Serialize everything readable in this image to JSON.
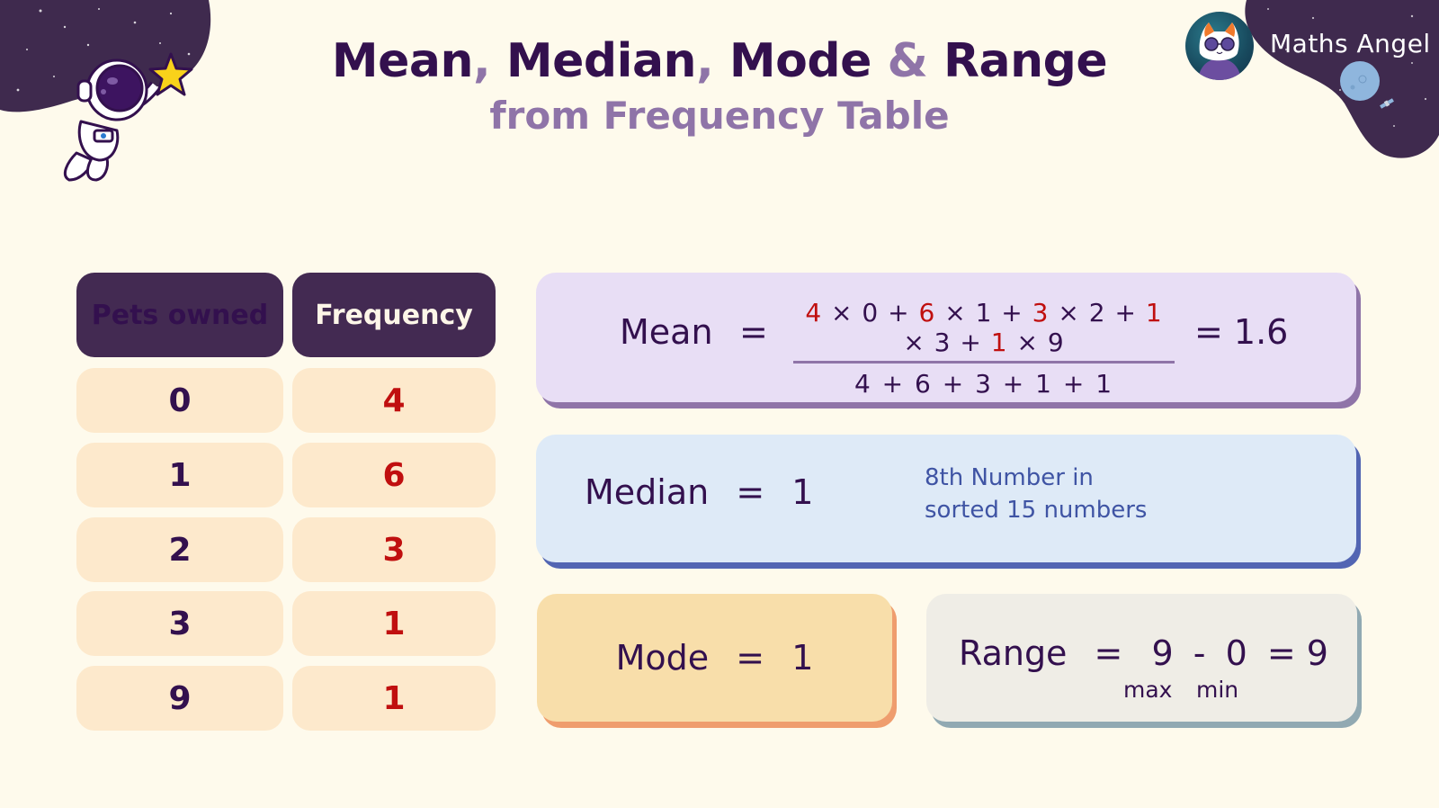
{
  "header": {
    "title_parts": [
      {
        "text": "Mean",
        "accent": false
      },
      {
        "text": ", ",
        "accent": true
      },
      {
        "text": "Median",
        "accent": false
      },
      {
        "text": ", ",
        "accent": true
      },
      {
        "text": "Mode",
        "accent": false
      },
      {
        "text": " & ",
        "accent": true
      },
      {
        "text": "Range",
        "accent": false
      }
    ],
    "subtitle": "from Frequency Table"
  },
  "brand": {
    "name": "Maths Angel",
    "avatar_icon": "cat-with-sunglasses-icon"
  },
  "decorations": {
    "left": "astronaut-holding-star-icon",
    "right": "moon-and-satellite-icon"
  },
  "table": {
    "headers": [
      "Pets owned",
      "Frequency"
    ],
    "rows": [
      {
        "value": "0",
        "frequency": "4"
      },
      {
        "value": "1",
        "frequency": "6"
      },
      {
        "value": "2",
        "frequency": "3"
      },
      {
        "value": "3",
        "frequency": "1"
      },
      {
        "value": "9",
        "frequency": "1"
      }
    ]
  },
  "mean": {
    "label": "Mean",
    "equals": "=",
    "numerator_terms": [
      {
        "f": "4",
        "x": "0"
      },
      {
        "f": "6",
        "x": "1"
      },
      {
        "f": "3",
        "x": "2"
      },
      {
        "f": "1",
        "x": "3"
      },
      {
        "f": "1",
        "x": "9"
      }
    ],
    "times": "×",
    "plus": "+",
    "denominator": "4 + 6 + 3 + 1 + 1",
    "result": "= 1.6"
  },
  "median": {
    "label": "Median",
    "equals": "=",
    "value": "1",
    "note_line1": "8th Number in",
    "note_line2": "sorted 15 numbers"
  },
  "mode": {
    "label": "Mode",
    "equals": "=",
    "value": "1"
  },
  "range": {
    "label": "Range",
    "equals": "=",
    "max": "9",
    "minus": "-",
    "min": "0",
    "result": "= 9",
    "max_label": "max",
    "min_label": "min"
  },
  "colors": {
    "background": "#fefaec",
    "dark_purple": "#33104e",
    "accent_purple": "#8f74a8",
    "frequency_red": "#c00f0f",
    "table_header": "#432a52",
    "table_cell": "#fde9cc",
    "mean_card": "#e8def5",
    "median_card": "#deeaf7",
    "mode_card": "#f8deaa",
    "range_card": "#efede6"
  }
}
